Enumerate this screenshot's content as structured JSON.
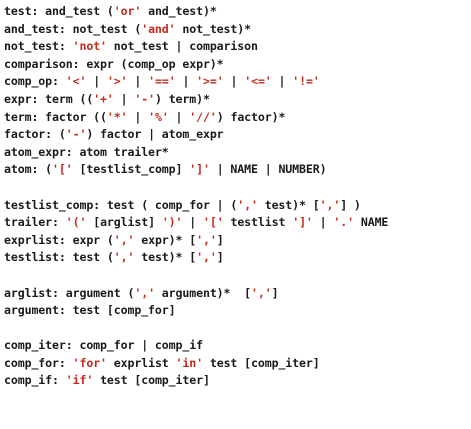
{
  "colors": {
    "text": "#1a1a1a",
    "string_literal": "#c22a1e",
    "background": "#ffffff"
  },
  "blocks": [
    {
      "lines": [
        [
          {
            "t": "test: and_test ("
          },
          {
            "s": "'or'"
          },
          {
            "t": " and_test)*"
          }
        ],
        [
          {
            "t": "and_test: not_test ("
          },
          {
            "s": "'and'"
          },
          {
            "t": " not_test)*"
          }
        ],
        [
          {
            "t": "not_test: "
          },
          {
            "s": "'not'"
          },
          {
            "t": " not_test | comparison"
          }
        ],
        [
          {
            "t": "comparison: expr (comp_op expr)*"
          }
        ],
        [
          {
            "t": "comp_op: "
          },
          {
            "s": "'<'"
          },
          {
            "t": " | "
          },
          {
            "s": "'>'"
          },
          {
            "t": " | "
          },
          {
            "s": "'=='"
          },
          {
            "t": " | "
          },
          {
            "s": "'>='"
          },
          {
            "t": " | "
          },
          {
            "s": "'<='"
          },
          {
            "t": " | "
          },
          {
            "s": "'!='"
          }
        ],
        [
          {
            "t": "expr: term (("
          },
          {
            "s": "'+'"
          },
          {
            "t": " | "
          },
          {
            "s": "'-'"
          },
          {
            "t": ") term)*"
          }
        ],
        [
          {
            "t": "term: factor (("
          },
          {
            "s": "'*'"
          },
          {
            "t": " | "
          },
          {
            "s": "'%'"
          },
          {
            "t": " | "
          },
          {
            "s": "'//'"
          },
          {
            "t": ") factor)*"
          }
        ],
        [
          {
            "t": "factor: ("
          },
          {
            "s": "'-'"
          },
          {
            "t": ") factor | atom_expr"
          }
        ],
        [
          {
            "t": "atom_expr: atom trailer*"
          }
        ],
        [
          {
            "t": "atom: ("
          },
          {
            "s": "'['"
          },
          {
            "t": " [testlist_comp] "
          },
          {
            "s": "']'"
          },
          {
            "t": " | NAME | NUMBER)"
          }
        ]
      ]
    },
    {
      "lines": [
        [
          {
            "t": "testlist_comp: test ( comp_for | ("
          },
          {
            "s": "','"
          },
          {
            "t": " test)* ["
          },
          {
            "s": "','"
          },
          {
            "t": "] )"
          }
        ],
        [
          {
            "t": "trailer: "
          },
          {
            "s": "'('"
          },
          {
            "t": " [arglist] "
          },
          {
            "s": "')'"
          },
          {
            "t": " | "
          },
          {
            "s": "'['"
          },
          {
            "t": " testlist "
          },
          {
            "s": "']'"
          },
          {
            "t": " | "
          },
          {
            "s": "'.'"
          },
          {
            "t": " NAME"
          }
        ],
        [
          {
            "t": "exprlist: expr ("
          },
          {
            "s": "','"
          },
          {
            "t": " expr)* ["
          },
          {
            "s": "','"
          },
          {
            "t": "]"
          }
        ],
        [
          {
            "t": "testlist: test ("
          },
          {
            "s": "','"
          },
          {
            "t": " test)* ["
          },
          {
            "s": "','"
          },
          {
            "t": "]"
          }
        ]
      ]
    },
    {
      "lines": [
        [
          {
            "t": "arglist: argument ("
          },
          {
            "s": "','"
          },
          {
            "t": " argument)*  ["
          },
          {
            "s": "','"
          },
          {
            "t": "]"
          }
        ],
        [
          {
            "t": "argument: test [comp_for]"
          }
        ]
      ]
    },
    {
      "lines": [
        [
          {
            "t": "comp_iter: comp_for | comp_if"
          }
        ],
        [
          {
            "t": "comp_for: "
          },
          {
            "s": "'for'"
          },
          {
            "t": " exprlist "
          },
          {
            "s": "'in'"
          },
          {
            "t": " test [comp_iter]"
          }
        ],
        [
          {
            "t": "comp_if: "
          },
          {
            "s": "'if'"
          },
          {
            "t": " test [comp_iter]"
          }
        ]
      ]
    }
  ]
}
